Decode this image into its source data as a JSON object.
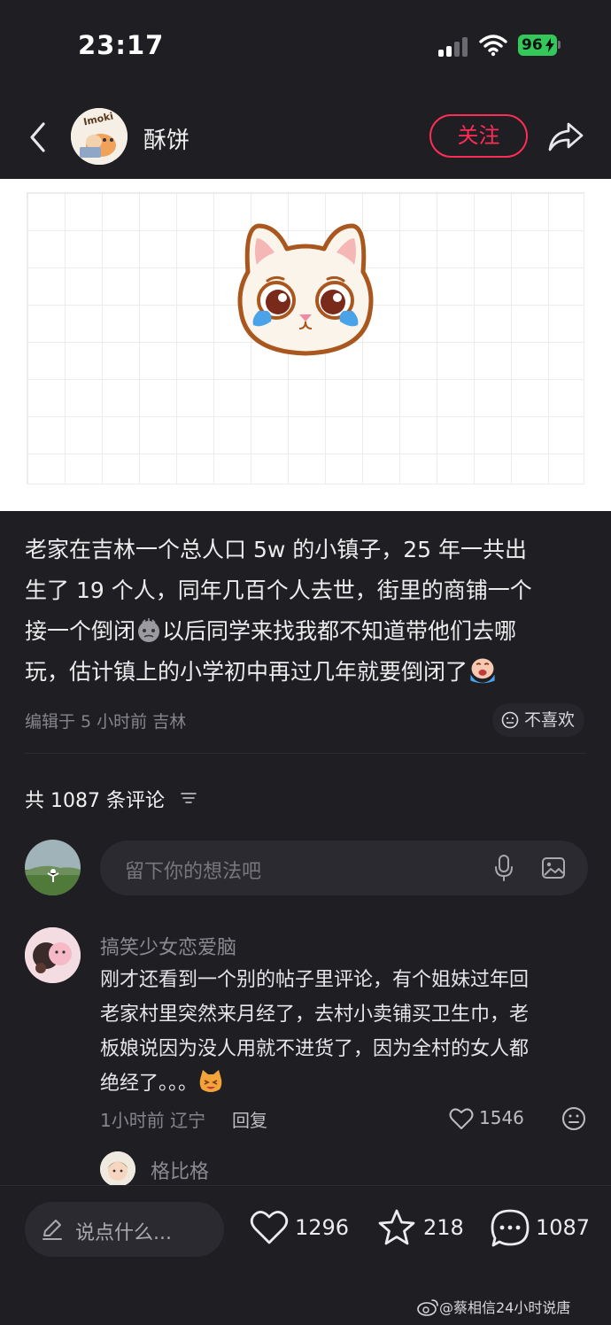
{
  "status_bar": {
    "time": "23:17",
    "battery": "96"
  },
  "header": {
    "username": "酥饼",
    "follow_label": "关注",
    "avatar_text": "Imoki"
  },
  "post": {
    "text_line1": "老家在吉林一个总人口 5w 的小镇子，25 年一共出",
    "text_line2": "生了 19 个人，同年几百个人去世，街里的商铺一个",
    "text_line3a": "接一个倒闭",
    "text_line3b": "以后同学来找我都不知道带他们去哪",
    "text_line4": "玩，估计镇上的小学初中再过几年就要倒闭了",
    "meta": "编辑于 5 小时前 吉林",
    "dislike_label": "不喜欢"
  },
  "comments_header": {
    "label": "共 1087 条评论"
  },
  "comment_input": {
    "placeholder": "留下你的想法吧"
  },
  "comment": {
    "user": "搞笑少女恋爱脑",
    "line1": "刚才还看到一个别的帖子里评论，有个姐妹过年回",
    "line2": "老家村里突然来月经了，去村小卖铺买卫生巾，老",
    "line3": "板娘说因为没人用就不进货了，因为全村的女人都",
    "line4": "绝经了。。。",
    "meta": "1小时前 辽宁",
    "reply_label": "回复",
    "likes": "1546"
  },
  "reply_preview": {
    "user": "格比格"
  },
  "bottom_bar": {
    "input_placeholder": "说点什么...",
    "likes": "1296",
    "favorites": "218",
    "comments": "1087"
  },
  "watermark": {
    "text": "@蔡相信24小时说唐"
  },
  "colors": {
    "accent": "#ff2d55",
    "background": "#1e1e23",
    "battery": "#34c759"
  }
}
